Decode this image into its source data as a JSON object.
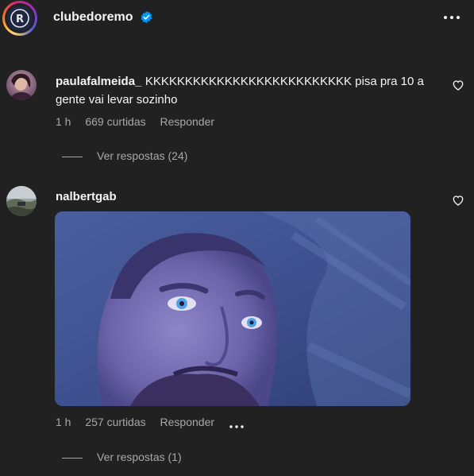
{
  "post": {
    "account_name": "clubedoremo",
    "verified_icon": "verified-badge-icon",
    "more_icon": "more-options-icon"
  },
  "comments": [
    {
      "username": "paulafalmeida_",
      "text": "KKKKKKKKKKKKKKKKKKKKKKKKKK pisa pra 10 a gente vai levar sozinho",
      "time": "1 h",
      "likes": "669 curtidas",
      "reply_label": "Responder",
      "view_replies": "Ver respostas (24)"
    },
    {
      "username": "nalbertgab",
      "text": "",
      "time": "1 h",
      "likes": "257 curtidas",
      "reply_label": "Responder",
      "view_replies": "Ver respostas (1)",
      "media": "gif"
    }
  ],
  "colors": {
    "background": "#212121",
    "primary_text": "#f5f5f5",
    "secondary_text": "#a8a8a8",
    "verified_blue": "#0095f6"
  }
}
